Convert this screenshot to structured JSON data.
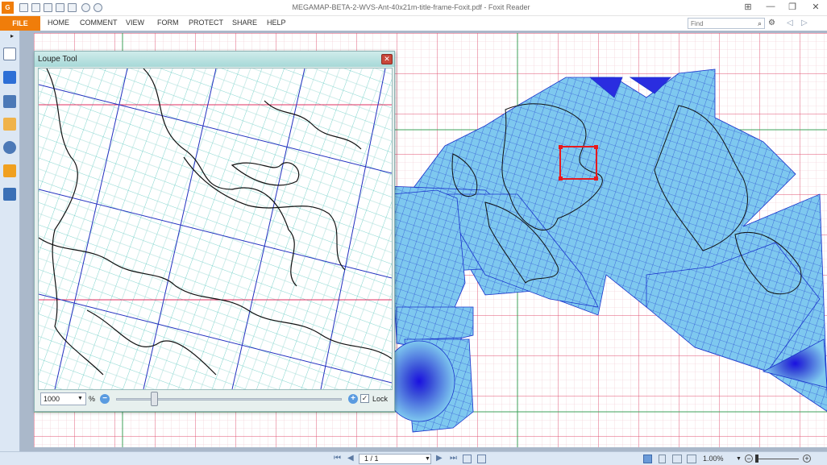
{
  "window": {
    "title": "MEGAMAP-BETA-2-WVS-Ant-40x21m-title-frame-Foxit.pdf - Foxit Reader",
    "logo": "G",
    "controls": [
      "⊞",
      "—",
      "❐",
      "✕"
    ]
  },
  "menu": {
    "file": "FILE",
    "items": [
      "HOME",
      "COMMENT",
      "VIEW",
      "FORM",
      "PROTECT",
      "SHARE",
      "HELP"
    ]
  },
  "search": {
    "placeholder": "Find",
    "icon": "search-icon",
    "glyph": "⌕"
  },
  "toolbar_icons": {
    "settings": "⚙",
    "prev": "◁",
    "next": "▷"
  },
  "sidebar": {
    "toggle": "▸",
    "items": [
      "pages-icon",
      "layers-icon",
      "bookmarks-icon",
      "comments-icon",
      "attachments-icon",
      "security-icon",
      "signature-icon"
    ]
  },
  "loupe": {
    "title": "Loupe Tool",
    "close": "✕",
    "zoom_value": "1000",
    "zoom_unit": "%",
    "zoom_out": "−",
    "zoom_in": "+",
    "zoom_fraction": 0.17,
    "lock_label": "Lock",
    "lock_checked": "✓"
  },
  "status": {
    "page": "1 / 1",
    "zoom": "1.00%",
    "nav": [
      "⏮",
      "◀",
      "▶",
      "⏭"
    ]
  },
  "colors": {
    "accent": "#f07d0a",
    "grid_red": "#e05070",
    "grid_green": "#3da05a",
    "map_fill": "#7ec8ef",
    "map_line": "#1a33cc",
    "selection": "#e8191c"
  }
}
